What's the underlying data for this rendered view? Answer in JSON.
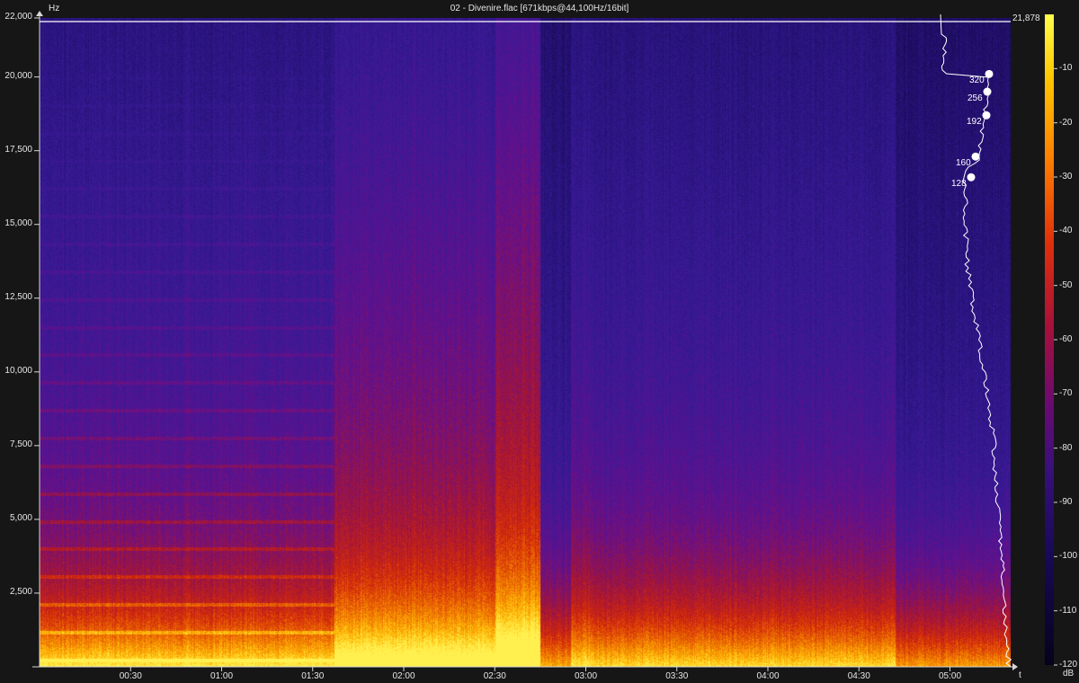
{
  "title": "02 - Divenire.flac [671kbps@44,100Hz/16bit]",
  "colors": {
    "background": "#161616",
    "axis": "#d8d8d8",
    "text": "#e6e6e6",
    "curve": "#ffffff"
  },
  "chart_data": {
    "type": "heatmap",
    "title": "02 - Divenire.flac [671kbps@44,100Hz/16bit]",
    "xlabel": "t",
    "ylabel": "Hz",
    "colorbar_label": "dB",
    "x_range_seconds": [
      0,
      320
    ],
    "ylim": [
      0,
      22000
    ],
    "zlim": [
      -120,
      0
    ],
    "x_ticks": [
      "00:30",
      "01:00",
      "01:30",
      "02:00",
      "02:30",
      "03:00",
      "03:30",
      "04:00",
      "04:30",
      "05:00"
    ],
    "x_tick_seconds": [
      30,
      60,
      90,
      120,
      150,
      180,
      210,
      240,
      270,
      300
    ],
    "y_ticks": [
      "22,000",
      "20,000",
      "17,500",
      "15,000",
      "12,500",
      "10,000",
      "7,500",
      "5,000",
      "2,500"
    ],
    "y_tick_values": [
      22000,
      20000,
      17500,
      15000,
      12500,
      10000,
      7500,
      5000,
      2500
    ],
    "db_ticks": [
      "-10",
      "-20",
      "-30",
      "-40",
      "-50",
      "-60",
      "-70",
      "-80",
      "-90",
      "-100",
      "-110",
      "-120"
    ],
    "db_tick_values": [
      -10,
      -20,
      -30,
      -40,
      -50,
      -60,
      -70,
      -80,
      -90,
      -100,
      -110,
      -120
    ],
    "cutoff_line_hz": 21878,
    "cutoff_label": "21,878",
    "bitrate_markers": [
      {
        "label": "320",
        "hz": 20100
      },
      {
        "label": "256",
        "hz": 19500
      },
      {
        "label": "192",
        "hz": 18700
      },
      {
        "label": "160",
        "hz": 17300
      },
      {
        "label": "128",
        "hz": 16600
      }
    ],
    "segments": [
      {
        "start_s": 0,
        "end_s": 97,
        "intensity": "moderate"
      },
      {
        "start_s": 97,
        "end_s": 182,
        "intensity": "high"
      },
      {
        "start_s": 182,
        "end_s": 282,
        "intensity": "moderate"
      },
      {
        "start_s": 282,
        "end_s": 320,
        "intensity": "low"
      }
    ],
    "grid": false
  }
}
